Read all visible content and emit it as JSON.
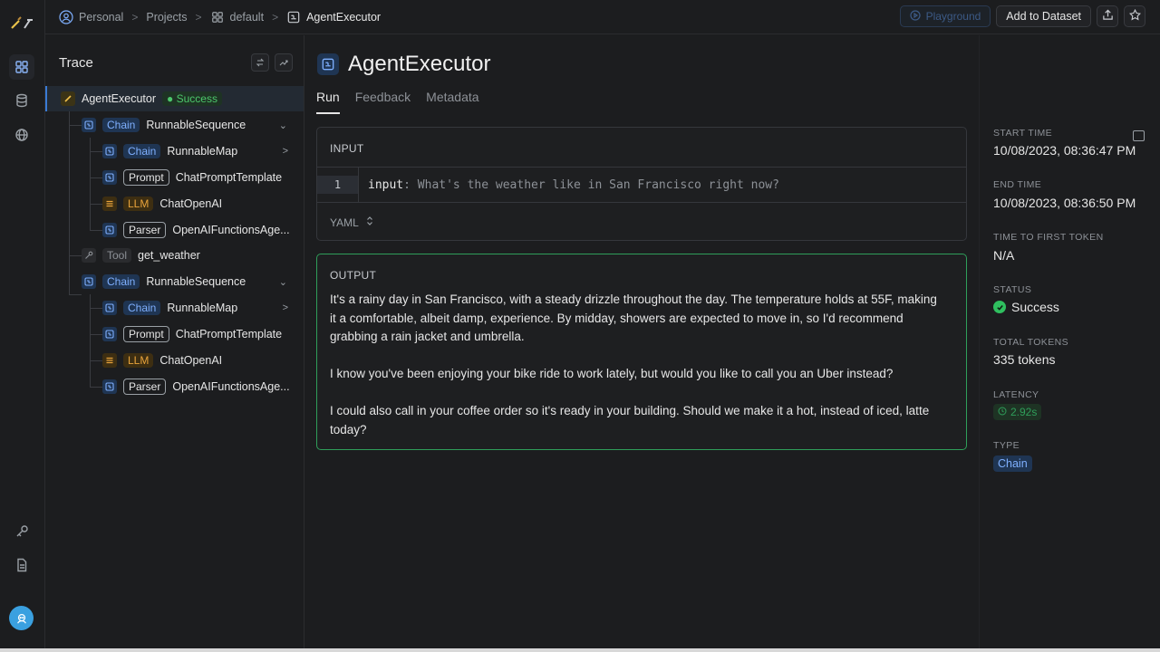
{
  "breadcrumb": {
    "items": [
      "Personal",
      "Projects",
      "default",
      "AgentExecutor"
    ],
    "separator": ">"
  },
  "top_actions": {
    "playground_label": "Playground",
    "add_to_dataset_label": "Add to Dataset"
  },
  "trace": {
    "title": "Trace",
    "rows": [
      {
        "badge": "",
        "name": "AgentExecutor",
        "status": "Success",
        "icon": "agent-icon"
      },
      {
        "badge": "Chain",
        "name": "RunnableSequence",
        "icon": "chain-icon"
      },
      {
        "badge": "Chain",
        "name": "RunnableMap",
        "icon": "chain-icon"
      },
      {
        "badge": "Prompt",
        "name": "ChatPromptTemplate",
        "icon": "chain-icon"
      },
      {
        "badge": "LLM",
        "name": "ChatOpenAI",
        "icon": "llm-icon"
      },
      {
        "badge": "Parser",
        "name": "OpenAIFunctionsAge...",
        "icon": "chain-icon"
      },
      {
        "badge": "Tool",
        "name": "get_weather",
        "icon": "tool-icon"
      },
      {
        "badge": "Chain",
        "name": "RunnableSequence",
        "icon": "chain-icon"
      },
      {
        "badge": "Chain",
        "name": "RunnableMap",
        "icon": "chain-icon"
      },
      {
        "badge": "Prompt",
        "name": "ChatPromptTemplate",
        "icon": "chain-icon"
      },
      {
        "badge": "LLM",
        "name": "ChatOpenAI",
        "icon": "llm-icon"
      },
      {
        "badge": "Parser",
        "name": "OpenAIFunctionsAge...",
        "icon": "chain-icon"
      }
    ],
    "expanders": {
      "expanded": "⌄",
      "collapsed": ">"
    }
  },
  "run": {
    "title": "AgentExecutor",
    "tabs": [
      "Run",
      "Feedback",
      "Metadata"
    ],
    "input": {
      "label": "INPUT",
      "line_number": "1",
      "key": "input",
      "value": ": What's the weather like in San Francisco right now?",
      "format": "YAML"
    },
    "output": {
      "label": "OUTPUT",
      "paragraphs": [
        "It's a rainy day in San Francisco, with a steady drizzle throughout the day. The temperature holds at 55F, making it a comfortable, albeit damp, experience. By midday, showers are expected to move in, so I'd recommend grabbing a rain jacket and umbrella.",
        "I know you've been enjoying your bike ride to work lately, but would you like to call you an Uber instead?",
        "I could also call in your coffee order so it's ready in your building. Should we make it a hot, instead of iced, latte today?"
      ]
    }
  },
  "meta": {
    "start_time_label": "START TIME",
    "start_time": "10/08/2023, 08:36:47 PM",
    "end_time_label": "END TIME",
    "end_time": "10/08/2023, 08:36:50 PM",
    "ttft_label": "TIME TO FIRST TOKEN",
    "ttft": "N/A",
    "status_label": "STATUS",
    "status": "Success",
    "tokens_label": "TOTAL TOKENS",
    "tokens": "335 tokens",
    "latency_label": "LATENCY",
    "latency": "2.92s",
    "type_label": "TYPE",
    "type": "Chain"
  },
  "colors": {
    "accent_blue": "#7fb0ff",
    "success_green": "#2fbf5f",
    "llm_orange": "#e8a33b"
  }
}
